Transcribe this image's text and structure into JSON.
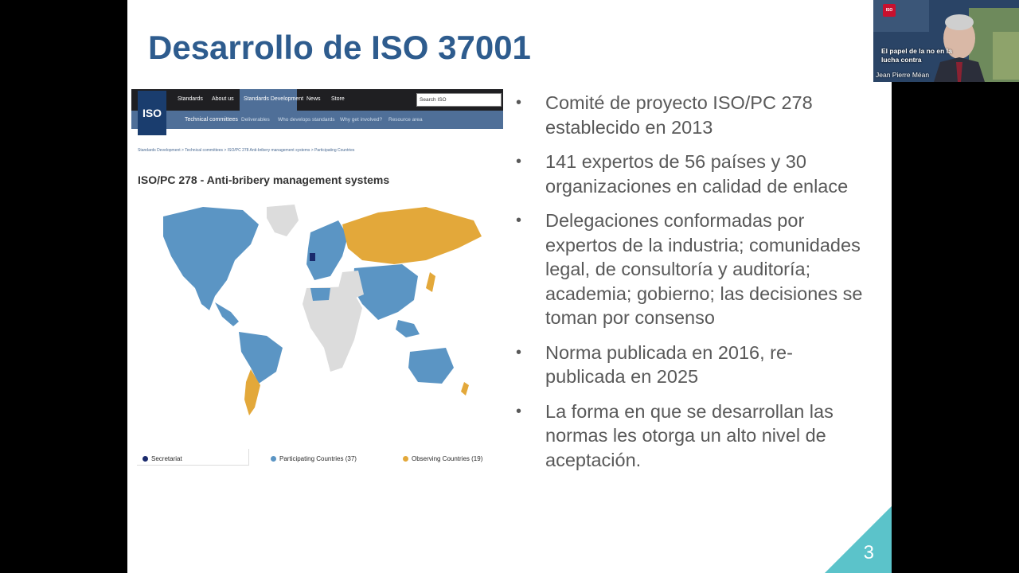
{
  "slide": {
    "title": "Desarrollo de ISO 37001",
    "page_number": "3",
    "accent_color": "#5bc3ca",
    "title_color": "#2e5c8e"
  },
  "iso_page": {
    "logo_text": "ISO",
    "top_nav": [
      "Standards",
      "About us",
      "Standards Development",
      "News",
      "Store"
    ],
    "active_nav": "Standards Development",
    "search_placeholder": "Search ISO",
    "sub_nav": [
      "Technical committees",
      "Deliverables",
      "Who develops standards",
      "Why get involved?",
      "Resource area"
    ],
    "breadcrumb": "Standards Development  >  Technical committees  >  ISO/PC 278 Anti-bribery management systems  >  Participating Countries",
    "heading": "ISO/PC 278 - Anti-bribery management systems",
    "legend": {
      "secretariat": "Secretariat",
      "participating": "Participating Countries (37)",
      "observing": "Observing Countries (19)"
    },
    "colors": {
      "secretariat": "#1a2a6c",
      "participating": "#5b95c4",
      "observing": "#e3a83a",
      "non_member": "#dcdcdc"
    }
  },
  "bullets": [
    "Comité de proyecto ISO/PC 278 establecido en 2013",
    "141 expertos de 56 países y 30 organizaciones en calidad de enlace",
    "Delegaciones conformadas por expertos de la industria; comunidades legal, de consultoría y auditoría; academia; gobierno; las decisiones se toman por consenso",
    "Norma publicada en 2016, re-publicada en 2025",
    "La forma en que se desarrollan las normas les otorga un alto nivel de aceptación."
  ],
  "webcam": {
    "badge": "ISO",
    "caption_line1": "El papel de la no        en la",
    "caption_line2": "lucha contra",
    "participant_name": "Jean Pierre Méan"
  }
}
